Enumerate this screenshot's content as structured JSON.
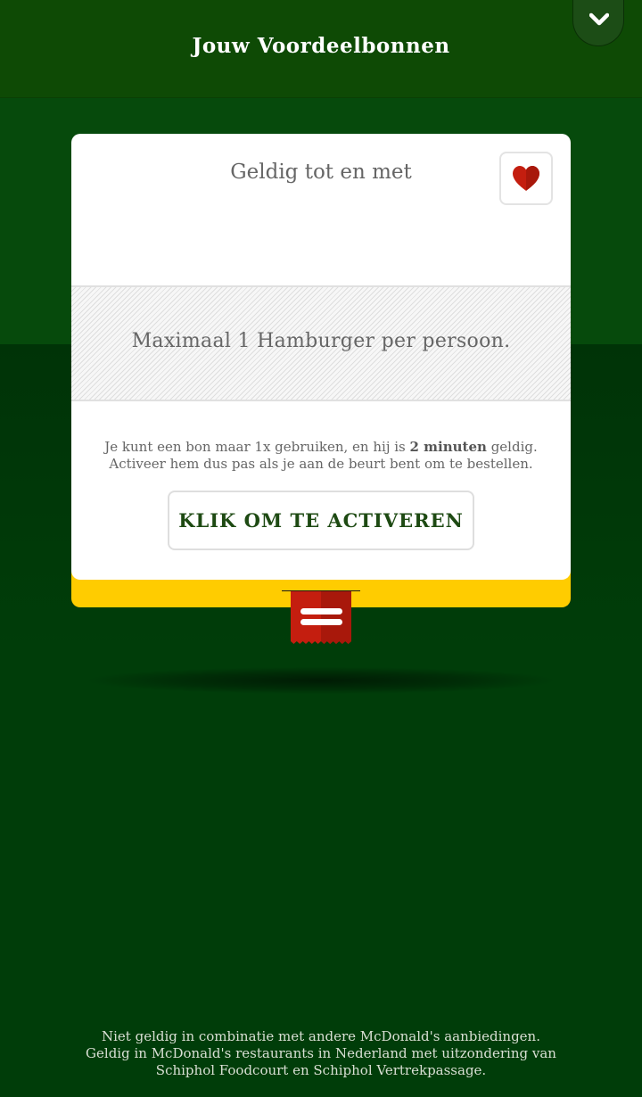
{
  "header": {
    "title": "Jouw Voordeelbonnen",
    "collapse_icon": "chevron-down-icon"
  },
  "coupon": {
    "valid_label": "Geldig tot en met",
    "favorite_icon": "heart-icon",
    "offer_text": "Maximaal 1 Hamburger per persoon.",
    "info_part1": "Je kunt een bon maar 1x gebruiken, en hij is ",
    "info_bold": "2 minuten",
    "info_part2": " geldig.",
    "info_line2": "Activeer hem dus pas als je aan de beurt bent om te bestellen.",
    "activate_label": "KLIK OM TE ACTIVEREN",
    "menu_icon": "menu-icon"
  },
  "footer": {
    "line1": "Niet geldig in combinatie met andere McDonald's aanbiedingen.",
    "line2": "Geldig in McDonald's restaurants in Nederland met uitzondering van",
    "line3": "Schiphol Foodcourt en Schiphol Vertrekpassage."
  },
  "colors": {
    "background": "#003d09",
    "header": "#0e4a05",
    "accent_yellow": "#ffcc00",
    "accent_red": "#c41e0f",
    "button_text": "#1e4a13"
  }
}
